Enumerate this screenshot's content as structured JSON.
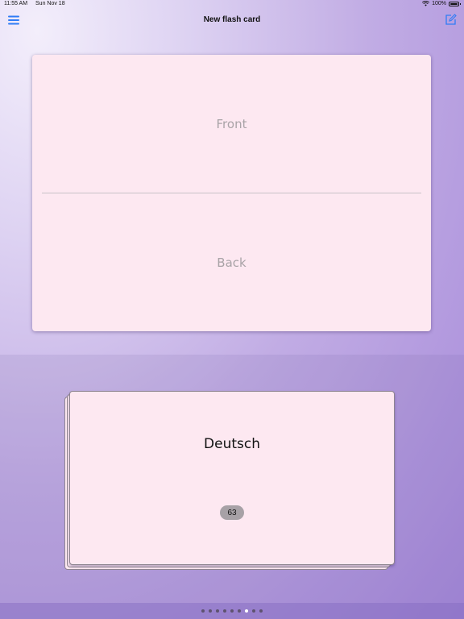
{
  "status_bar": {
    "time": "11:55 AM",
    "date": "Sun Nov 18",
    "battery_text": "100%",
    "icons": [
      "wifi-icon",
      "battery-icon"
    ]
  },
  "nav": {
    "title": "New flash card",
    "left_icon": "hamburger-menu-icon",
    "right_icon": "compose-icon",
    "accent_color": "#2f7cf6"
  },
  "editor": {
    "front_placeholder": "Front",
    "back_placeholder": "Back",
    "card_color": "#fde8f1"
  },
  "deck": {
    "title": "Deutsch",
    "count": "63"
  },
  "pagination": {
    "total": 9,
    "current": 7
  }
}
